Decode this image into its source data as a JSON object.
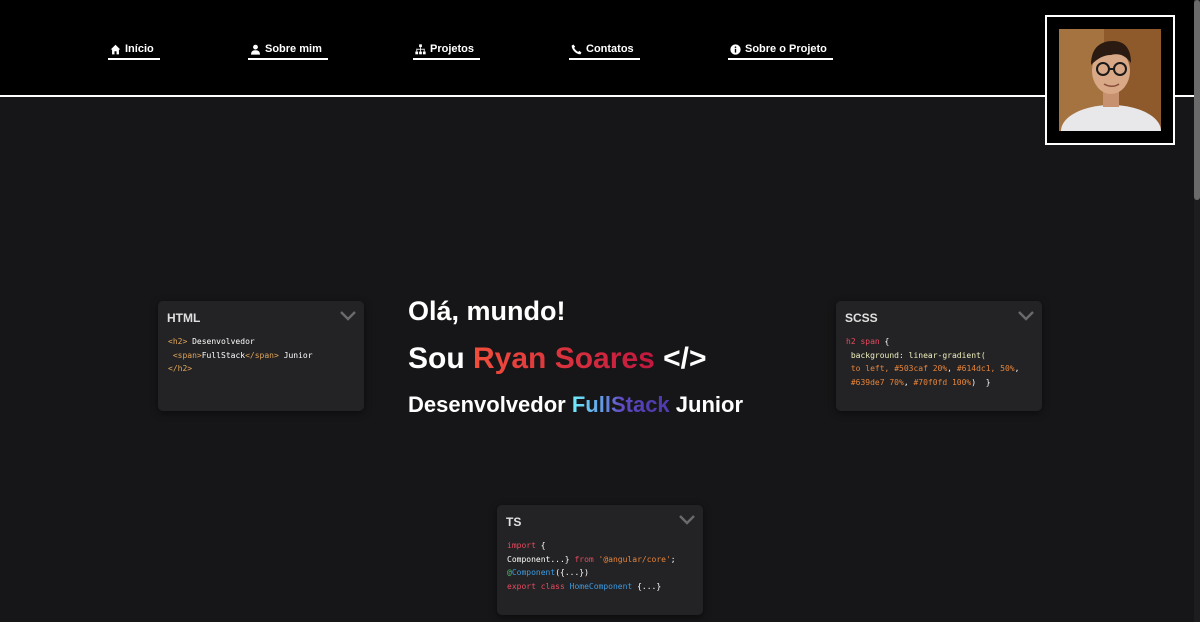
{
  "nav": {
    "items": [
      {
        "label": "Início",
        "icon": "home-icon"
      },
      {
        "label": "Sobre mim",
        "icon": "user-icon"
      },
      {
        "label": "Projetos",
        "icon": "sitemap-icon"
      },
      {
        "label": "Contatos",
        "icon": "phone-icon"
      },
      {
        "label": "Sobre o Projeto",
        "icon": "info-circle-icon"
      }
    ]
  },
  "hero": {
    "greeting": "Olá, mundo!",
    "intro_prefix": "Sou",
    "name": "Ryan Soares",
    "code_symbol": "</>",
    "role_prefix": "Desenvolvedor",
    "role_highlight": "FullStack",
    "role_suffix": "Junior"
  },
  "cards": {
    "html": {
      "title": "HTML",
      "line1_tag": "<h2>",
      "line1_text": " Desenvolvedor",
      "line2_open": "<span>",
      "line2_text": "FullStack",
      "line2_close": "</span>",
      "line2_tail": " Junior",
      "line3_tag": "</h2>"
    },
    "scss": {
      "title": "SCSS",
      "line1_sel": "h2 span",
      "line1_brace": " {",
      "line2_prop": "background",
      "line2_val": ": linear-gradient(",
      "line3_a": "to left, ",
      "line3_b": "#503caf 20%",
      "line3_c": ", ",
      "line3_d": "#614dc1, 50%",
      "line3_e": ",",
      "line4_a": "#639de7 70%",
      "line4_b": ", ",
      "line4_c": "#70f0fd 100%",
      "line4_d": ")  }"
    },
    "ts": {
      "title": "TS",
      "line1_kw": "import",
      "line1_rest": " {",
      "line2_text": "Component...}",
      "line2_from": " from ",
      "line2_str": "'@angular/core'",
      "line2_end": ";",
      "line3_dec": "@",
      "line3_name": "Component",
      "line3_rest": "({...})",
      "line4_kw": "export class ",
      "line4_name": "HomeComponent",
      "line4_rest": " {...}"
    }
  },
  "colors": {
    "background": "#161618",
    "topbar": "#000000",
    "card": "#232325",
    "name_gradient": [
      "#f24e3c",
      "#c1173f"
    ],
    "role_gradient": [
      "#503caf",
      "#614dc1",
      "#639de7",
      "#70f0fd"
    ]
  }
}
